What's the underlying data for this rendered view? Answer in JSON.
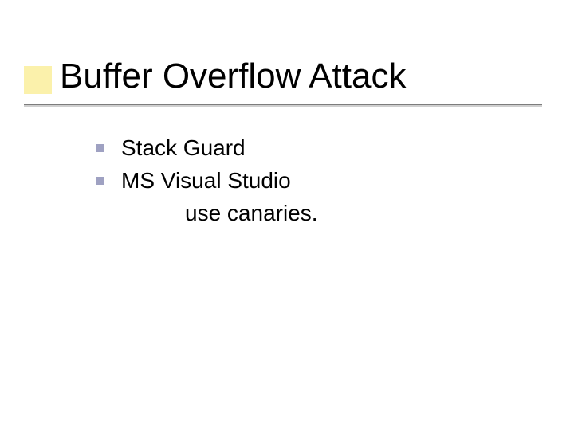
{
  "slide": {
    "title": "Buffer Overflow Attack",
    "bullets": [
      {
        "text": "Stack Guard"
      },
      {
        "text": "MS Visual Studio"
      }
    ],
    "sublines": [
      "use canaries."
    ]
  }
}
